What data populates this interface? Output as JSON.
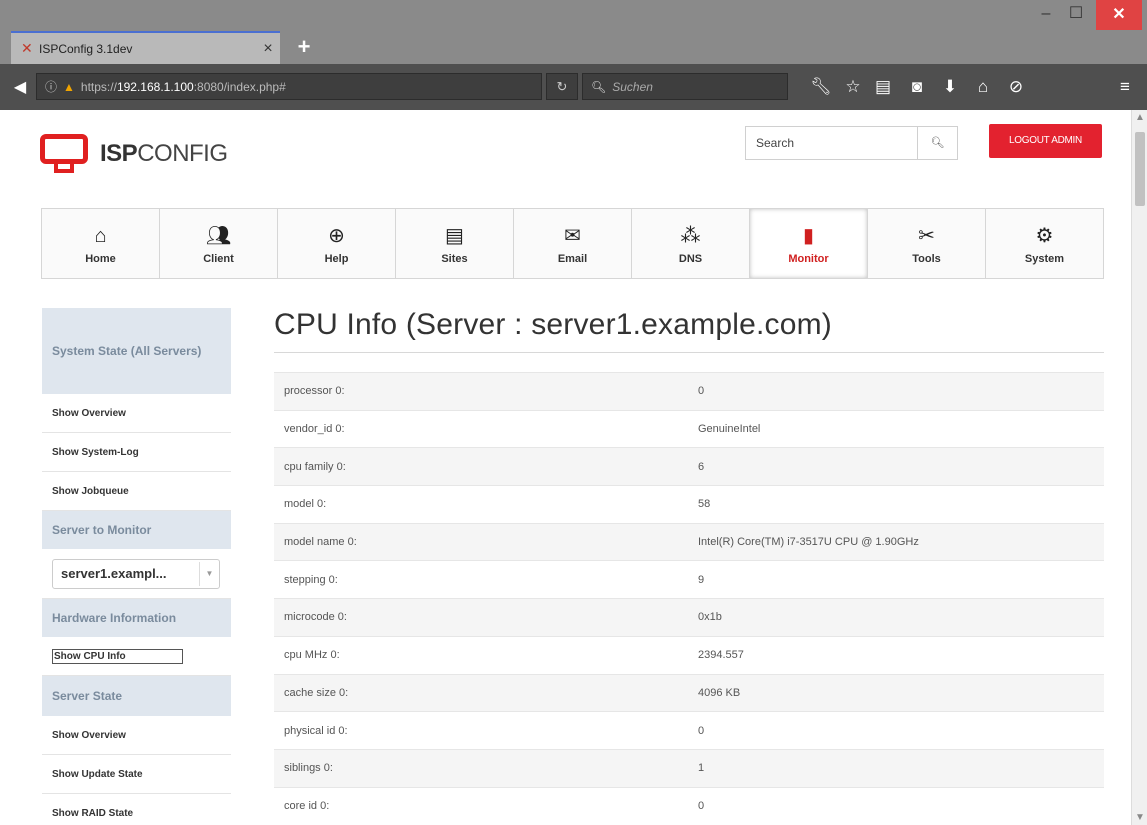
{
  "browser": {
    "tab_title": "ISPConfig 3.1dev",
    "tab_icon": "ispconfig-favicon",
    "url_prefix": "https://",
    "url_host": "192.168.1.100",
    "url_rest": ":8080/index.php#",
    "search_placeholder": "Suchen"
  },
  "header": {
    "logo_bold": "ISP",
    "logo_rest": "CONFIG",
    "search_placeholder": "Search",
    "logout_label": "LOGOUT ADMIN"
  },
  "mainnav": [
    {
      "label": "Home",
      "icon": "home-icon"
    },
    {
      "label": "Client",
      "icon": "users-icon"
    },
    {
      "label": "Help",
      "icon": "lifebuoy-icon"
    },
    {
      "label": "Sites",
      "icon": "browser-window-icon"
    },
    {
      "label": "Email",
      "icon": "envelope-icon"
    },
    {
      "label": "DNS",
      "icon": "network-icon"
    },
    {
      "label": "Monitor",
      "icon": "monitor-server-icon",
      "active": true
    },
    {
      "label": "Tools",
      "icon": "tools-icon"
    },
    {
      "label": "System",
      "icon": "gear-icon"
    }
  ],
  "sidebar": {
    "system_state_header": "System State (All Servers)",
    "system_state_links": [
      "Show Overview",
      "Show System-Log",
      "Show Jobqueue"
    ],
    "server_to_monitor_header": "Server to Monitor",
    "server_selected": "server1.exampl...",
    "hardware_header": "Hardware Information",
    "hardware_links": [
      "Show CPU Info"
    ],
    "server_state_header": "Server State",
    "server_state_links": [
      "Show Overview",
      "Show Update State",
      "Show RAID State"
    ]
  },
  "main": {
    "title": "CPU Info (Server : server1.example.com)",
    "rows": [
      {
        "key": "processor 0:",
        "value": "0"
      },
      {
        "key": "vendor_id 0:",
        "value": "GenuineIntel"
      },
      {
        "key": "cpu family 0:",
        "value": "6"
      },
      {
        "key": "model 0:",
        "value": "58"
      },
      {
        "key": "model name 0:",
        "value": "Intel(R) Core(TM) i7-3517U CPU @ 1.90GHz"
      },
      {
        "key": "stepping 0:",
        "value": "9"
      },
      {
        "key": "microcode 0:",
        "value": "0x1b"
      },
      {
        "key": "cpu MHz 0:",
        "value": "2394.557"
      },
      {
        "key": "cache size 0:",
        "value": "4096 KB"
      },
      {
        "key": "physical id 0:",
        "value": "0"
      },
      {
        "key": "siblings 0:",
        "value": "1"
      },
      {
        "key": "core id 0:",
        "value": "0"
      }
    ]
  },
  "colors": {
    "accent_red": "#e3222f",
    "sidebar_header_bg": "#dfe6ee",
    "sidebar_header_text": "#7a8b9d"
  }
}
